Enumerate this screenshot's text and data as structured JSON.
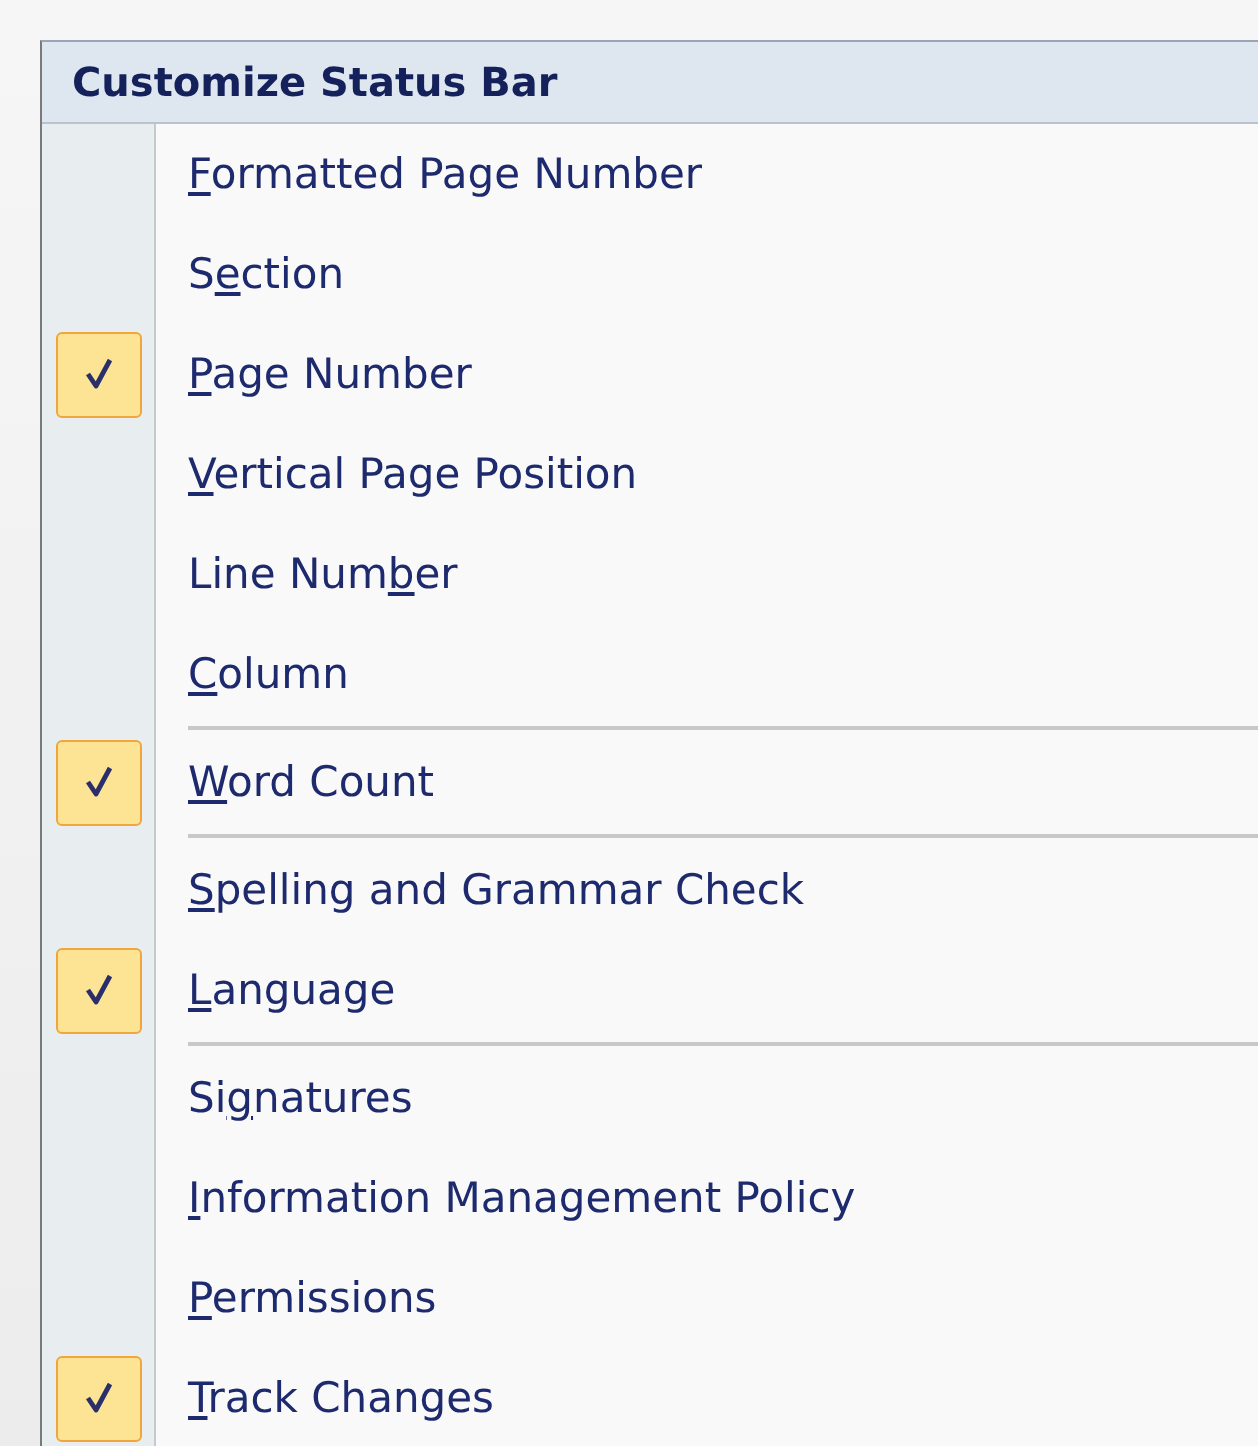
{
  "menu": {
    "title": "Customize Status Bar",
    "items": [
      {
        "kind": "option",
        "access_key": "F",
        "label_after": "ormatted Page Number",
        "checked": false
      },
      {
        "kind": "option",
        "label_before": "S",
        "access_key": "e",
        "label_after": "ction",
        "checked": false
      },
      {
        "kind": "option",
        "access_key": "P",
        "label_after": "age Number",
        "checked": true
      },
      {
        "kind": "option",
        "access_key": "V",
        "label_after": "ertical Page Position",
        "checked": false
      },
      {
        "kind": "option",
        "label_before": "Line Num",
        "access_key": "b",
        "label_after": "er",
        "checked": false
      },
      {
        "kind": "option",
        "access_key": "C",
        "label_after": "olumn",
        "checked": false
      },
      {
        "kind": "separator"
      },
      {
        "kind": "option",
        "access_key": "W",
        "label_after": "ord Count",
        "checked": true
      },
      {
        "kind": "separator"
      },
      {
        "kind": "option",
        "access_key": "S",
        "label_after": "pelling and Grammar Check",
        "checked": false
      },
      {
        "kind": "option",
        "access_key": "L",
        "label_after": "anguage",
        "checked": true
      },
      {
        "kind": "separator"
      },
      {
        "kind": "option",
        "label_before": "Si",
        "access_key": "g",
        "label_after": "natures",
        "checked": false
      },
      {
        "kind": "option",
        "access_key": "I",
        "label_after": "nformation Management Policy",
        "checked": false
      },
      {
        "kind": "option",
        "access_key": "P",
        "label_after": "ermissions",
        "checked": false
      },
      {
        "kind": "option",
        "access_key": "T",
        "label_after": "rack Changes",
        "checked": true
      }
    ]
  }
}
